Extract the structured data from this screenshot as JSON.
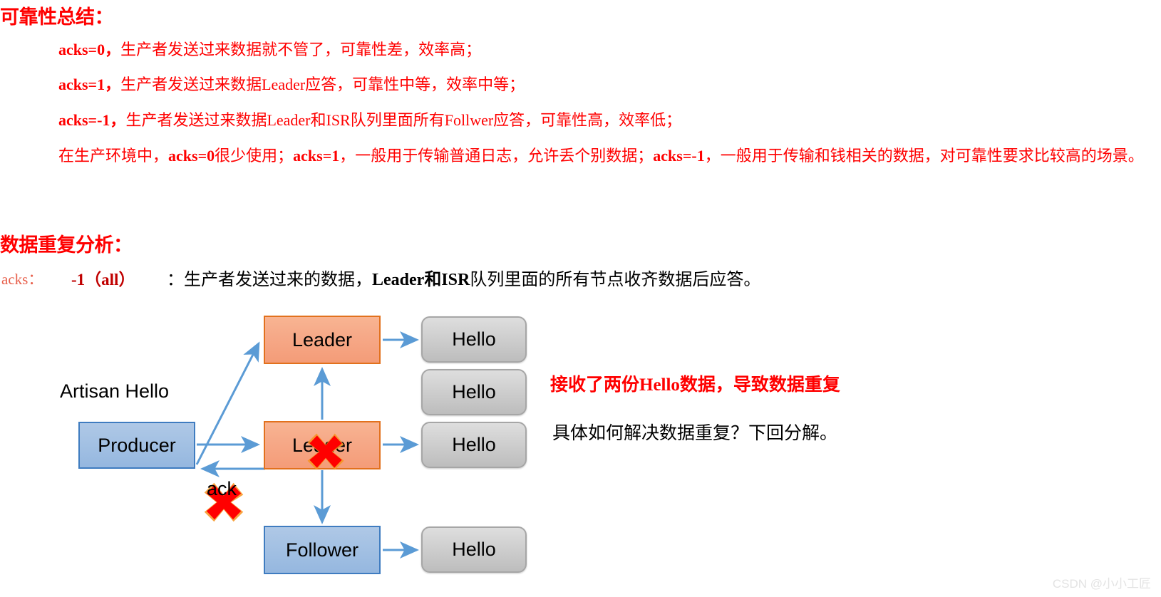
{
  "sections": {
    "reliability": {
      "heading": "可靠性总结：",
      "lines": [
        {
          "bold": "acks=0，",
          "rest": "生产者发送过来数据就不管了，可靠性差，效率高；"
        },
        {
          "bold": "acks=1，",
          "rest": "生产者发送过来数据Leader应答，可靠性中等，效率中等；"
        },
        {
          "bold": "acks=-1，",
          "rest": "生产者发送过来数据Leader和ISR队列里面所有Follwer应答，可靠性高，效率低；"
        }
      ],
      "paragraph": {
        "seg1": "在生产环境中，",
        "seg2_bold": "acks=0",
        "seg3": "很少使用；",
        "seg4_bold": "acks=1",
        "seg5": "，一般用于传输普通日志，允许丢个别数据；",
        "seg6_bold": "acks=-1",
        "seg7": "，一般用于传输和钱相关的数据，对可靠性要求比较高的场景。"
      }
    },
    "duplicate": {
      "heading": "数据重复分析：",
      "acks_label": "acks：",
      "acks_value": "-1（all）",
      "acks_desc_prefix": "：生产者发送过来的数据，",
      "acks_desc_bold": "Leader和ISR",
      "acks_desc_suffix": "队列里面的所有节点收齐数据后应答。"
    }
  },
  "diagram": {
    "producer_label": "Producer",
    "artisan_label": "Artisan Hello",
    "ack_label": "ack",
    "leader_top_label": "Leader",
    "leader_mid_label": "Leader",
    "follower_label": "Follower",
    "hello_labels": [
      "Hello",
      "Hello",
      "Hello",
      "Hello"
    ],
    "colors": {
      "leader_fill": "#F6A887",
      "leader_border": "#E2711D",
      "blue_fill": "#A2C0E3",
      "blue_border": "#3F7CC0",
      "hello_fill": "#CFCFCF",
      "hello_border": "#A6A6A6",
      "arrow": "#5B9BD5",
      "cross": "#FF0000"
    }
  },
  "notes": {
    "red_note": "接收了两份Hello数据，导致数据重复",
    "black_note": "具体如何解决数据重复？下回分解。"
  },
  "watermark": "CSDN @小小工匠"
}
